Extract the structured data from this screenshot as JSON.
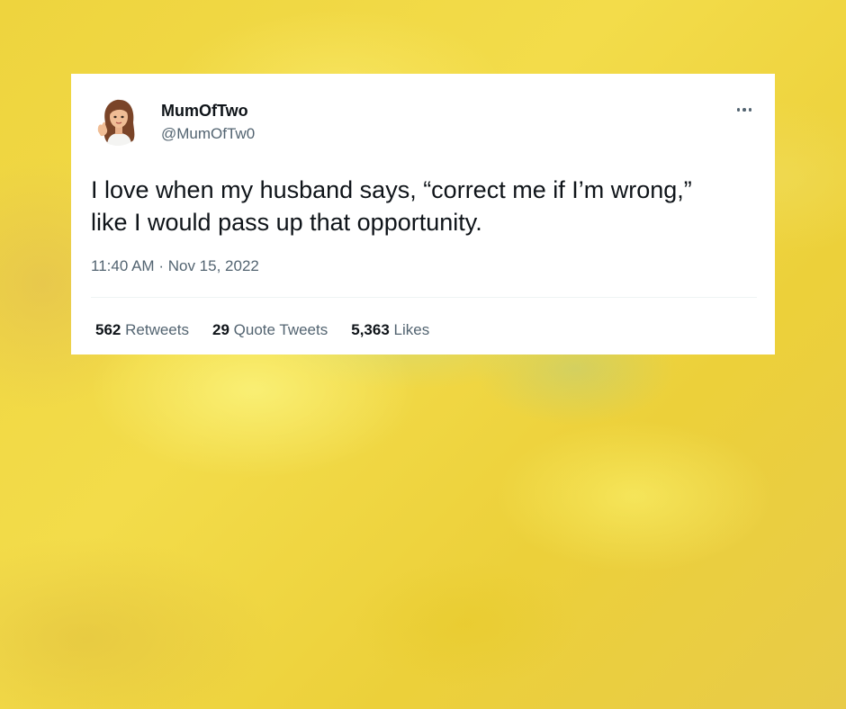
{
  "tweet": {
    "display_name": "MumOfTwo",
    "handle": "@MumOfTw0",
    "more_icon": "more-horizontal-icon",
    "text": "I love when my husband says, “correct me if I’m wrong,” like I would pass up that opportunity.",
    "time": "11:40 AM",
    "separator": "·",
    "date": "Nov 15, 2022",
    "stats": {
      "retweets": {
        "count": "562",
        "label": "Retweets"
      },
      "quotes": {
        "count": "29",
        "label": "Quote Tweets"
      },
      "likes": {
        "count": "5,363",
        "label": "Likes"
      }
    }
  },
  "colors": {
    "background": "#f0d83a",
    "card": "#ffffff",
    "primary_text": "#0f1419",
    "secondary_text": "#536471",
    "divider": "#eff3f4"
  }
}
